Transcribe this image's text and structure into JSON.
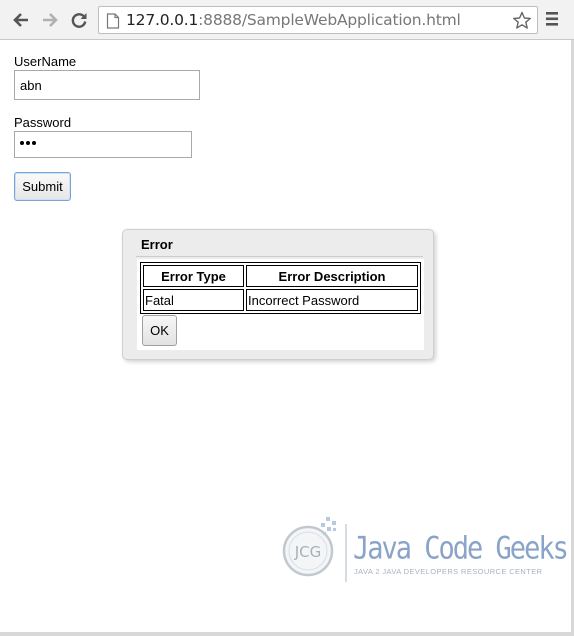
{
  "browser": {
    "url_host": "127.0.0.1",
    "url_rest": ":8888/SampleWebApplication.html",
    "icons": [
      "back-icon",
      "forward-icon",
      "reload-icon",
      "page-icon",
      "star-icon",
      "menu-icon"
    ]
  },
  "form": {
    "username_label": "UserName",
    "username_value": "abn",
    "password_label": "Password",
    "password_length": 3,
    "submit_label": "Submit"
  },
  "dialog": {
    "title": "Error",
    "table": {
      "headers": [
        "Error Type",
        "Error Description"
      ],
      "rows": [
        [
          "Fatal",
          "Incorrect Password"
        ]
      ]
    },
    "ok_label": "OK"
  },
  "watermark": {
    "logo_text": "JCG",
    "title": "Java Code Geeks",
    "subtitle": "JAVA 2 JAVA DEVELOPERS RESOURCE CENTER"
  }
}
